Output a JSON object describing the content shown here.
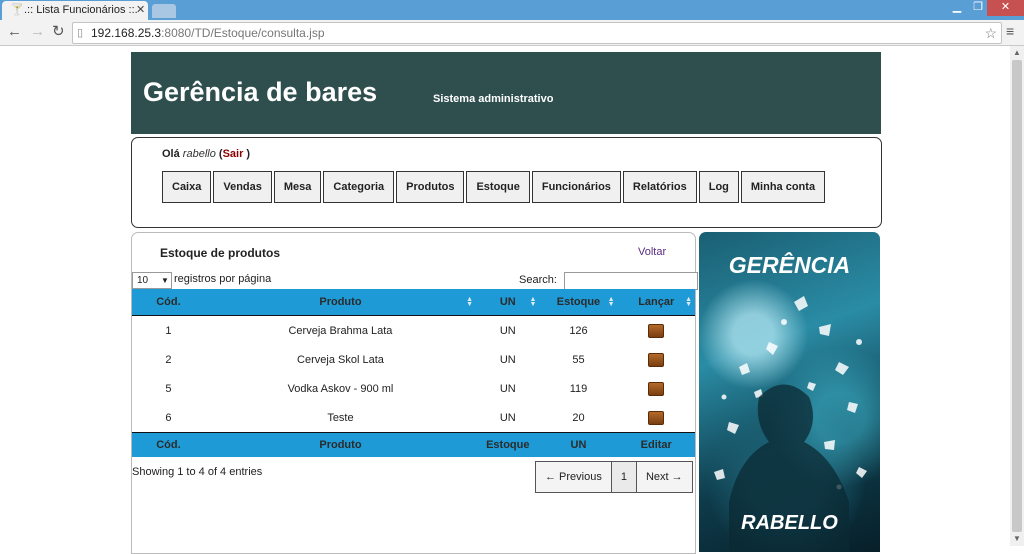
{
  "browser": {
    "tab_title": ".:: Lista Funcionários ::.",
    "url_host": "192.168.25.3",
    "url_path": ":8080/TD/Estoque/consulta.jsp"
  },
  "header": {
    "brand": "Gerência de bares",
    "subtitle": "Sistema administrativo"
  },
  "user_panel": {
    "greeting": "Olá",
    "username": "rabello",
    "logout": "Sair",
    "open_paren": "(",
    "close_paren": ")"
  },
  "nav": {
    "items": [
      "Caixa",
      "Vendas",
      "Mesa",
      "Categoria",
      "Produtos",
      "Estoque",
      "Funcionários",
      "Relatórios",
      "Log",
      "Minha conta"
    ]
  },
  "content": {
    "title": "Estoque de produtos",
    "back_link": "Voltar",
    "page_length": "10",
    "length_label": "registros por página",
    "search_label": "Search:",
    "search_value": ""
  },
  "table": {
    "columns": [
      "Cód.",
      "Produto",
      "UN",
      "Estoque",
      "Lançar"
    ],
    "footer_columns": [
      "Cód.",
      "Produto",
      "Estoque",
      "UN",
      "Editar"
    ],
    "rows": [
      {
        "cod": "1",
        "produto": "Cerveja Brahma Lata",
        "un": "UN",
        "estoque": "126"
      },
      {
        "cod": "2",
        "produto": "Cerveja Skol Lata",
        "un": "UN",
        "estoque": "55"
      },
      {
        "cod": "5",
        "produto": "Vodka Askov - 900 ml",
        "un": "UN",
        "estoque": "119"
      },
      {
        "cod": "6",
        "produto": "Teste",
        "un": "UN",
        "estoque": "20"
      }
    ],
    "launch_icon": "launch-stock-icon",
    "info": "Showing 1 to 4 of 4 entries"
  },
  "pagination": {
    "previous": "← Previous",
    "current_page": "1",
    "next": "Next →"
  },
  "banner": {
    "top_text": "GERÊNCIA",
    "bottom_text": "RABELLO"
  },
  "colors": {
    "header_bg": "#2f4f4f",
    "table_header_bg": "#1e9bd7",
    "logout": "#8b0000",
    "back_link": "#5a2d82"
  }
}
